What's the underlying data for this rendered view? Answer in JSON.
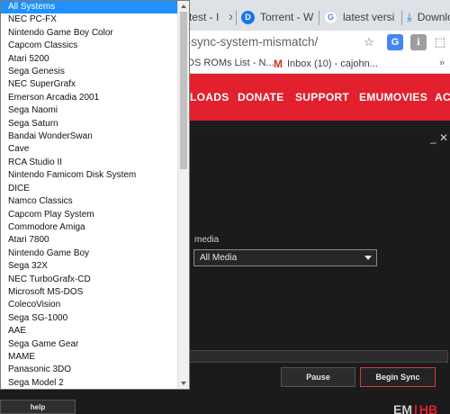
{
  "browser": {
    "tabs": [
      {
        "label": "test - I",
        "icon": "partial-tab"
      },
      {
        "label": "Torrent - W",
        "icon": "torrent-favicon"
      },
      {
        "label": "latest versi",
        "icon": "google-favicon"
      },
      {
        "label": "Downlo",
        "icon": "download-icon"
      }
    ],
    "url": "/-sync-system-mismatch/",
    "bookmarks": [
      {
        "label": "DS ROMs List - N..."
      },
      {
        "label": "Inbox (10) - cajohn...",
        "icon": "gmail-icon"
      }
    ]
  },
  "site": {
    "nav": [
      {
        "label": "LOADS"
      },
      {
        "label": "DONATE"
      },
      {
        "label": "SUPPORT"
      },
      {
        "label": "EMUMOVIES"
      },
      {
        "label": "ACT"
      }
    ],
    "accent_color": "#e2202e"
  },
  "dialog": {
    "window_controls": "_ ✕",
    "media_label": "media",
    "media_selected": "All Media",
    "pause_label": "Pause",
    "begin_label": "Begin Sync",
    "help_label": "help",
    "brand_em": "EM",
    "brand_sep": "|",
    "brand_hb": "HB"
  },
  "system_dropdown": {
    "selected": "All Systems",
    "options": [
      "All Systems",
      "NEC PC-FX",
      "Nintendo Game Boy Color",
      "Capcom Classics",
      "Atari 5200",
      "Sega Genesis",
      "NEC SuperGrafx",
      "Emerson Arcadia 2001",
      "Sega Naomi",
      "Sega Saturn",
      "Bandai WonderSwan",
      "Cave",
      "RCA Studio II",
      "Nintendo Famicom Disk System",
      "DICE",
      "Namco Classics",
      "Capcom Play System",
      "Commodore Amiga",
      "Atari 7800",
      "Nintendo Game Boy",
      "Sega 32X",
      "NEC TurboGrafx-CD",
      "Microsoft MS-DOS",
      "ColecoVision",
      "Sega SG-1000",
      "AAE",
      "Sega Game Gear",
      "MAME",
      "Panasonic 3DO",
      "Sega Model 2"
    ]
  }
}
